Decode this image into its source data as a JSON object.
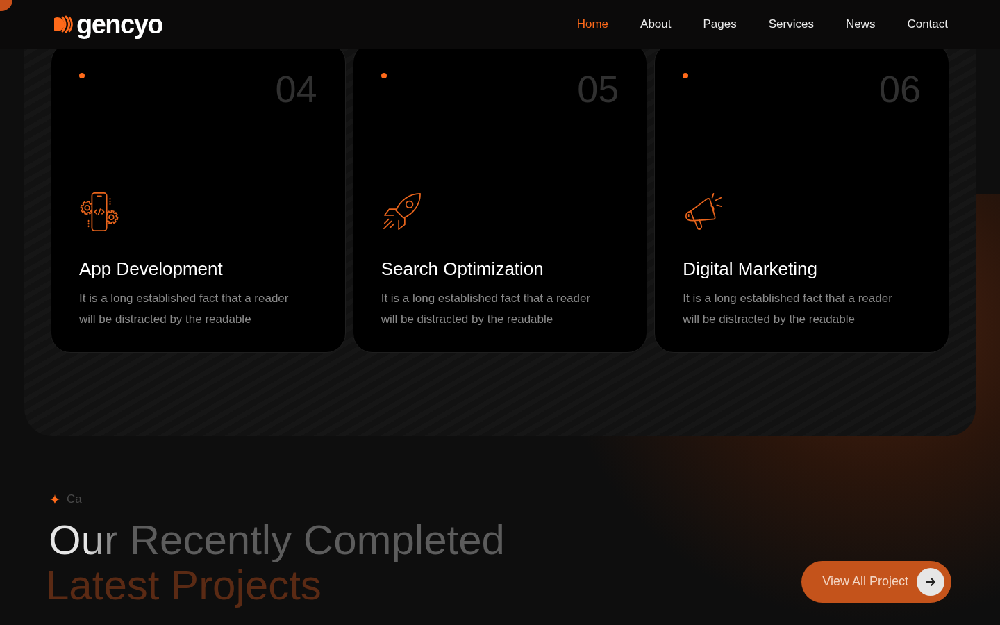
{
  "header": {
    "logo": "gencyo",
    "nav": [
      {
        "label": "Home",
        "selected": true
      },
      {
        "label": "About",
        "selected": false
      },
      {
        "label": "Pages",
        "selected": false
      },
      {
        "label": "Services",
        "selected": false
      },
      {
        "label": "News",
        "selected": false
      },
      {
        "label": "Contact",
        "selected": false
      }
    ]
  },
  "services": [
    {
      "number": "04",
      "title": "App Development",
      "description": "It is a long established fact that a reader will be distracted by the readable"
    },
    {
      "number": "05",
      "title": "Search Optimization",
      "description": "It is a long established fact that a reader will be distracted by the readable"
    },
    {
      "number": "06",
      "title": "Digital Marketing",
      "description": "It is a long established fact that a reader will be distracted by the readable"
    }
  ],
  "projects": {
    "eyebrow": "Ca",
    "title": "Our Recently Completed",
    "subtitle": "Latest Projects",
    "button": "View All Project"
  }
}
